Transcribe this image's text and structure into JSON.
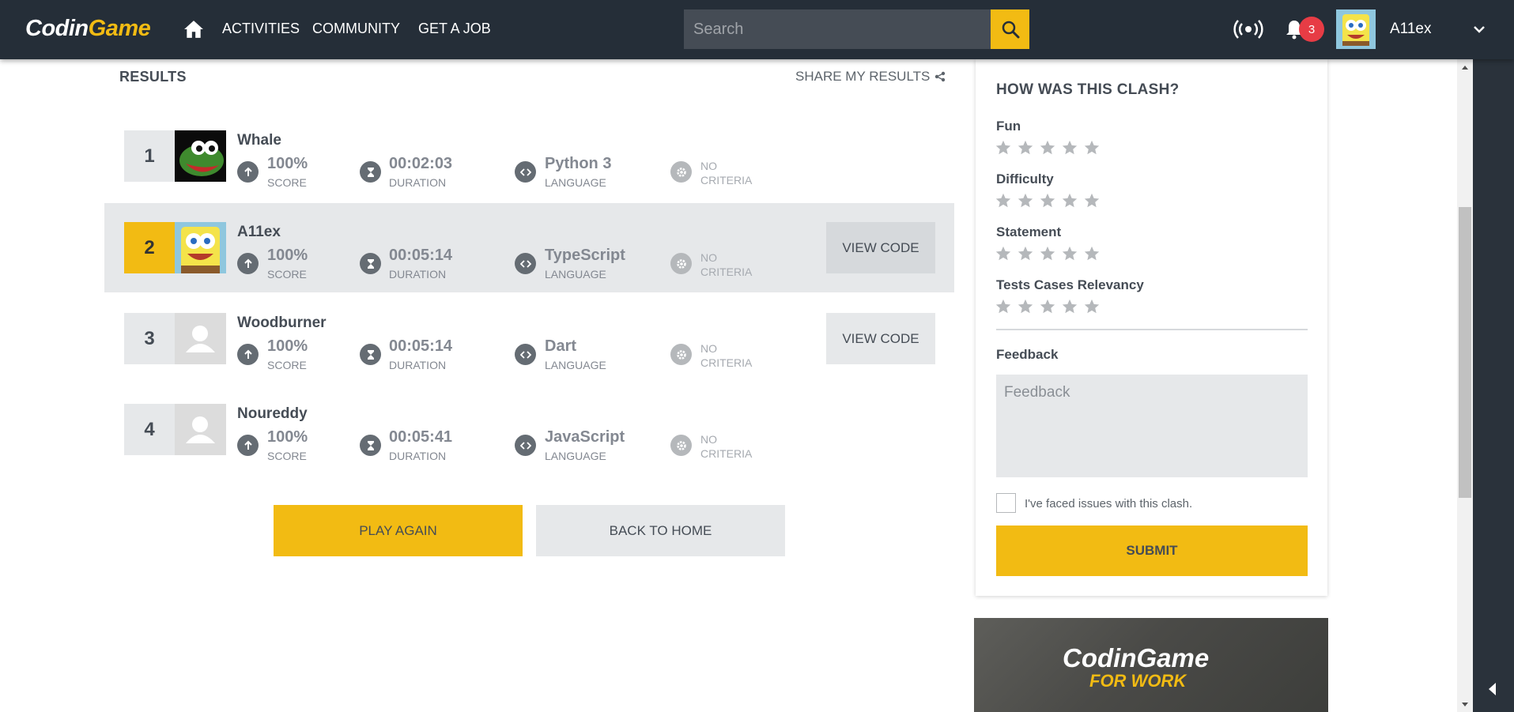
{
  "nav": {
    "logo_white": "Codin",
    "logo_yellow": "Game",
    "links": [
      "ACTIVITIES",
      "COMMUNITY",
      "GET A JOB"
    ],
    "search_placeholder": "Search",
    "notification_count": "3",
    "username": "A11ex"
  },
  "results": {
    "title": "RESULTS",
    "share_label": "SHARE MY RESULTS",
    "score_label": "SCORE",
    "duration_label": "DURATION",
    "language_label": "LANGUAGE",
    "criteria_value": "NO",
    "criteria_label": "CRITERIA",
    "view_code_label": "VIEW CODE",
    "players": [
      {
        "rank": "1",
        "name": "Whale",
        "score": "100%",
        "duration": "00:02:03",
        "language": "Python 3",
        "avatar": "frog-avatar"
      },
      {
        "rank": "2",
        "name": "A11ex",
        "score": "100%",
        "duration": "00:05:14",
        "language": "TypeScript",
        "avatar": "sponge-avatar"
      },
      {
        "rank": "3",
        "name": "Woodburner",
        "score": "100%",
        "duration": "00:05:14",
        "language": "Dart",
        "avatar": "default-avatar"
      },
      {
        "rank": "4",
        "name": "Noureddy",
        "score": "100%",
        "duration": "00:05:41",
        "language": "JavaScript",
        "avatar": "default-avatar"
      }
    ],
    "play_again": "PLAY AGAIN",
    "back_home": "BACK TO HOME"
  },
  "feedback": {
    "title": "HOW WAS THIS CLASH?",
    "criteria": [
      {
        "name": "Fun",
        "rating": 0
      },
      {
        "name": "Difficulty",
        "rating": 0
      },
      {
        "name": "Statement",
        "rating": 0
      },
      {
        "name": "Tests Cases Relevancy",
        "rating": 0
      }
    ],
    "feedback_label": "Feedback",
    "feedback_placeholder": "Feedback",
    "issues_label": "I've faced issues with this clash.",
    "submit_label": "SUBMIT"
  },
  "ad": {
    "logo": "CodinGame",
    "sub": "FOR WORK"
  },
  "colors": {
    "navbar": "#252e38",
    "accent": "#f2bb13",
    "text": "#454c55",
    "badge": "#e73c45"
  }
}
